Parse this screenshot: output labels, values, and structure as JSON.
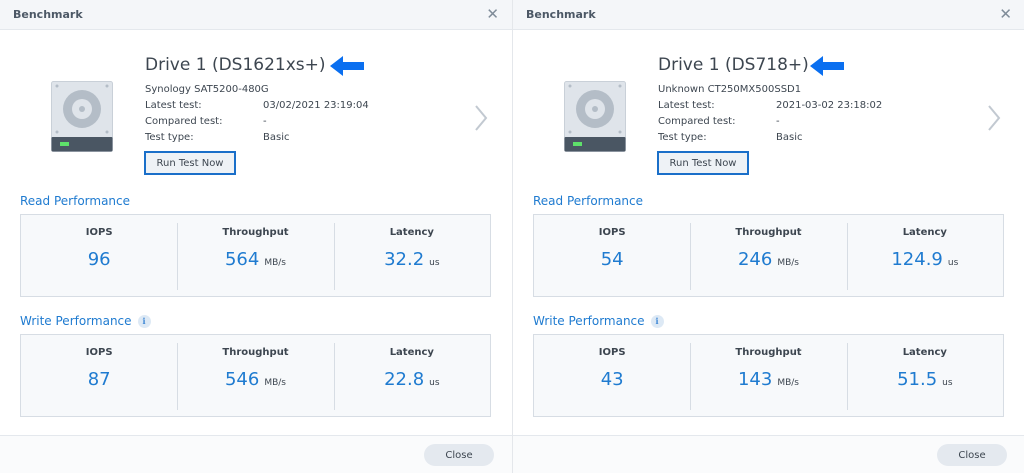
{
  "colors": {
    "accent": "#1f7bd0",
    "arrow": "#0a6ff0",
    "run_border": "#1a6fc9"
  },
  "dialogs": [
    {
      "title": "Benchmark",
      "close_glyph": "✕",
      "drive_title": "Drive 1 (DS1621xs+)",
      "model": "Synology SAT5200-480G",
      "info": [
        {
          "label": "Latest test:",
          "value": "03/02/2021 23:19:04"
        },
        {
          "label": "Compared test:",
          "value": "-"
        },
        {
          "label": "Test type:",
          "value": "Basic"
        }
      ],
      "run_button": "Run Test Now",
      "read": {
        "label": "Read Performance",
        "metrics": [
          {
            "name": "IOPS",
            "value": "96",
            "unit": ""
          },
          {
            "name": "Throughput",
            "value": "564",
            "unit": "MB/s"
          },
          {
            "name": "Latency",
            "value": "32.2",
            "unit": "us"
          }
        ]
      },
      "write": {
        "label": "Write Performance",
        "info_glyph": "i",
        "metrics": [
          {
            "name": "IOPS",
            "value": "87",
            "unit": ""
          },
          {
            "name": "Throughput",
            "value": "546",
            "unit": "MB/s"
          },
          {
            "name": "Latency",
            "value": "22.8",
            "unit": "us"
          }
        ]
      },
      "close_button": "Close"
    },
    {
      "title": "Benchmark",
      "close_glyph": "✕",
      "drive_title": "Drive 1 (DS718+)",
      "model": "Unknown CT250MX500SSD1",
      "info": [
        {
          "label": "Latest test:",
          "value": "2021-03-02 23:18:02"
        },
        {
          "label": "Compared test:",
          "value": "-"
        },
        {
          "label": "Test type:",
          "value": "Basic"
        }
      ],
      "run_button": "Run Test Now",
      "read": {
        "label": "Read Performance",
        "metrics": [
          {
            "name": "IOPS",
            "value": "54",
            "unit": ""
          },
          {
            "name": "Throughput",
            "value": "246",
            "unit": "MB/s"
          },
          {
            "name": "Latency",
            "value": "124.9",
            "unit": "us"
          }
        ]
      },
      "write": {
        "label": "Write Performance",
        "info_glyph": "i",
        "metrics": [
          {
            "name": "IOPS",
            "value": "43",
            "unit": ""
          },
          {
            "name": "Throughput",
            "value": "143",
            "unit": "MB/s"
          },
          {
            "name": "Latency",
            "value": "51.5",
            "unit": "us"
          }
        ]
      },
      "close_button": "Close"
    }
  ]
}
